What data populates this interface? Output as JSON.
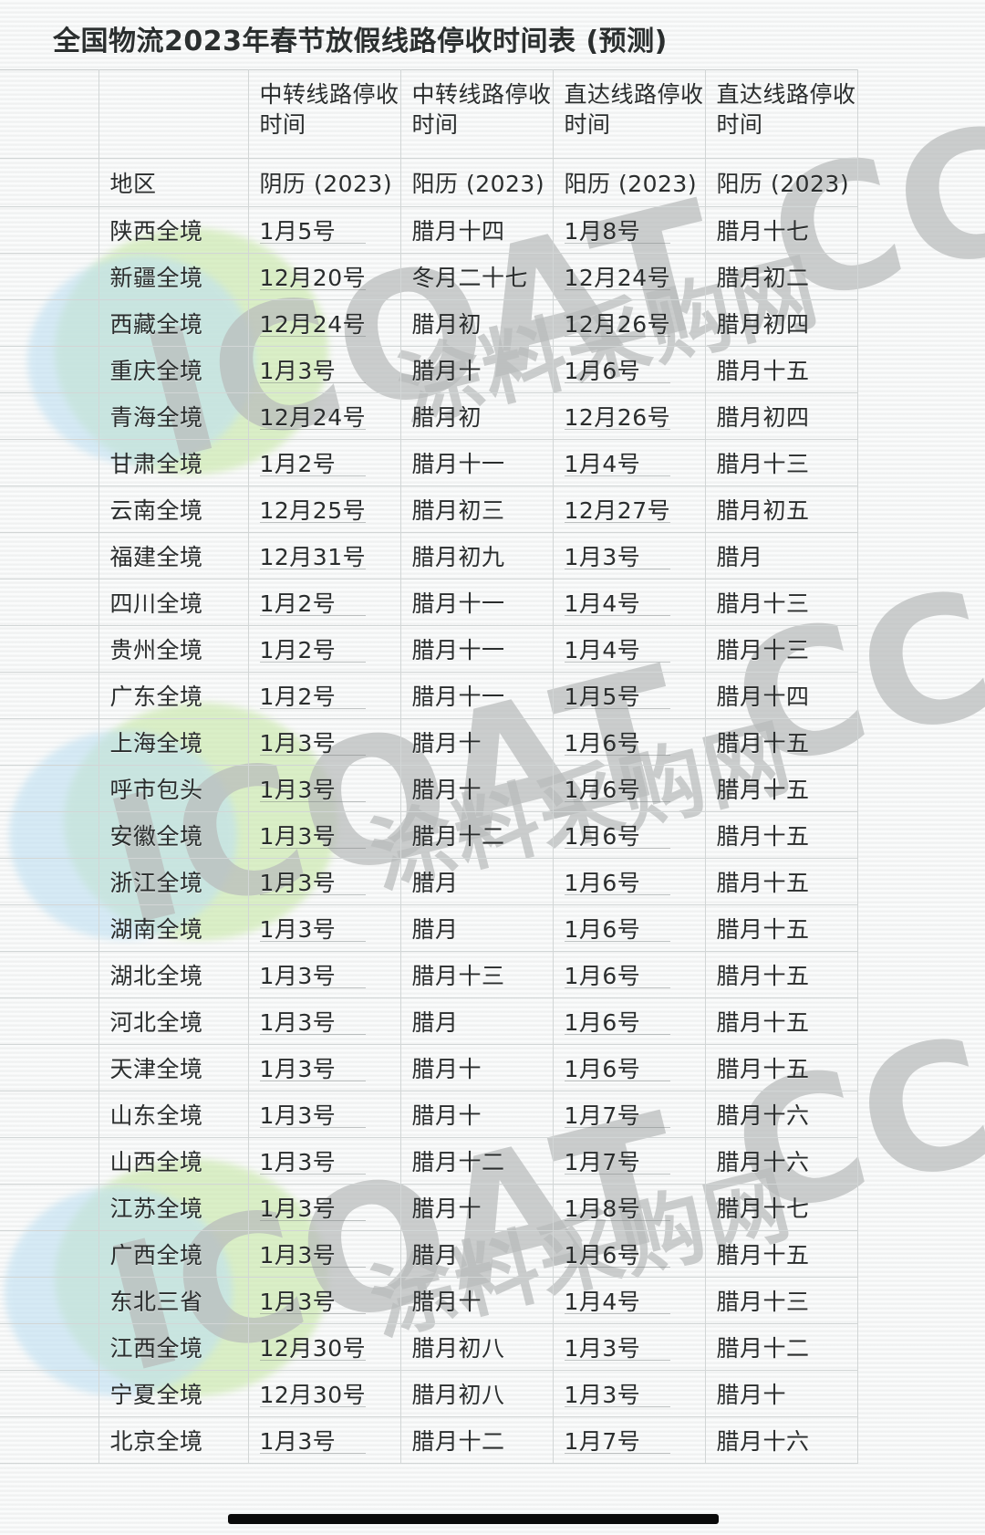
{
  "title": "全国物流2023年春节放假线路停收时间表 (预测)",
  "watermark": {
    "latin": "ICOAT CC",
    "cjk": "涂料采购网",
    "green": "#c8e8a8",
    "blue": "#bfe0f2",
    "text_color": "#b9bcbc"
  },
  "table": {
    "header": {
      "gutter": "",
      "region": "",
      "columns": [
        "中转线路停收时间",
        "中转线路停收时间",
        "直达线路停收时间",
        "直达线路停收时间"
      ]
    },
    "subheader": {
      "region": "地区",
      "columns": [
        "阴历 (2023)",
        "阳历 (2023)",
        "阳历 (2023)",
        "阳历 (2023)"
      ]
    },
    "rows": [
      {
        "region": "陕西全境",
        "c1": "1月5号",
        "c2": "腊月十四",
        "c3": "1月8号",
        "c4": "腊月十七"
      },
      {
        "region": "新疆全境",
        "c1": "12月20号",
        "c2": "冬月二十七",
        "c3": "12月24号",
        "c4": "腊月初二"
      },
      {
        "region": "西藏全境",
        "c1": "12月24号",
        "c2": "腊月初",
        "c3": "12月26号",
        "c4": "腊月初四"
      },
      {
        "region": "重庆全境",
        "c1": "1月3号",
        "c2": "腊月十",
        "c3": "1月6号",
        "c4": "腊月十五"
      },
      {
        "region": "青海全境",
        "c1": "12月24号",
        "c2": "腊月初",
        "c3": "12月26号",
        "c4": "腊月初四"
      },
      {
        "region": "甘肃全境",
        "c1": "1月2号",
        "c2": "腊月十一",
        "c3": "1月4号",
        "c4": "腊月十三"
      },
      {
        "region": "云南全境",
        "c1": "12月25号",
        "c2": "腊月初三",
        "c3": "12月27号",
        "c4": "腊月初五"
      },
      {
        "region": "福建全境",
        "c1": "12月31号",
        "c2": "腊月初九",
        "c3": "1月3号",
        "c4": "腊月"
      },
      {
        "region": "四川全境",
        "c1": "1月2号",
        "c2": "腊月十一",
        "c3": "1月4号",
        "c4": "腊月十三"
      },
      {
        "region": "贵州全境",
        "c1": "1月2号",
        "c2": "腊月十一",
        "c3": "1月4号",
        "c4": "腊月十三"
      },
      {
        "region": "广东全境",
        "c1": "1月2号",
        "c2": "腊月十一",
        "c3": "1月5号",
        "c4": "腊月十四"
      },
      {
        "region": "上海全境",
        "c1": "1月3号",
        "c2": "腊月十",
        "c3": "1月6号",
        "c4": "腊月十五"
      },
      {
        "region": "呼市包头",
        "c1": "1月3号",
        "c2": "腊月十",
        "c3": "1月6号",
        "c4": "腊月十五"
      },
      {
        "region": "安徽全境",
        "c1": "1月3号",
        "c2": "腊月十二",
        "c3": "1月6号",
        "c4": "腊月十五"
      },
      {
        "region": "浙江全境",
        "c1": "1月3号",
        "c2": "腊月",
        "c3": "1月6号",
        "c4": "腊月十五"
      },
      {
        "region": "湖南全境",
        "c1": "1月3号",
        "c2": "腊月",
        "c3": "1月6号",
        "c4": "腊月十五"
      },
      {
        "region": "湖北全境",
        "c1": "1月3号",
        "c2": "腊月十三",
        "c3": "1月6号",
        "c4": "腊月十五"
      },
      {
        "region": "河北全境",
        "c1": "1月3号",
        "c2": "腊月",
        "c3": "1月6号",
        "c4": "腊月十五"
      },
      {
        "region": "天津全境",
        "c1": "1月3号",
        "c2": "腊月十",
        "c3": "1月6号",
        "c4": "腊月十五"
      },
      {
        "region": "山东全境",
        "c1": "1月3号",
        "c2": "腊月十",
        "c3": "1月7号",
        "c4": "腊月十六"
      },
      {
        "region": "山西全境",
        "c1": "1月3号",
        "c2": "腊月十二",
        "c3": "1月7号",
        "c4": "腊月十六"
      },
      {
        "region": "江苏全境",
        "c1": "1月3号",
        "c2": "腊月十",
        "c3": "1月8号",
        "c4": "腊月十七"
      },
      {
        "region": "广西全境",
        "c1": "1月3号",
        "c2": "腊月",
        "c3": "1月6号",
        "c4": "腊月十五"
      },
      {
        "region": "东北三省",
        "c1": "1月3号",
        "c2": "腊月十",
        "c3": "1月4号",
        "c4": "腊月十三"
      },
      {
        "region": "江西全境",
        "c1": "12月30号",
        "c2": "腊月初八",
        "c3": "1月3号",
        "c4": "腊月十二"
      },
      {
        "region": "宁夏全境",
        "c1": "12月30号",
        "c2": "腊月初八",
        "c3": "1月3号",
        "c4": "腊月十"
      },
      {
        "region": "北京全境",
        "c1": "1月3号",
        "c2": "腊月十二",
        "c3": "1月7号",
        "c4": "腊月十六"
      }
    ]
  }
}
